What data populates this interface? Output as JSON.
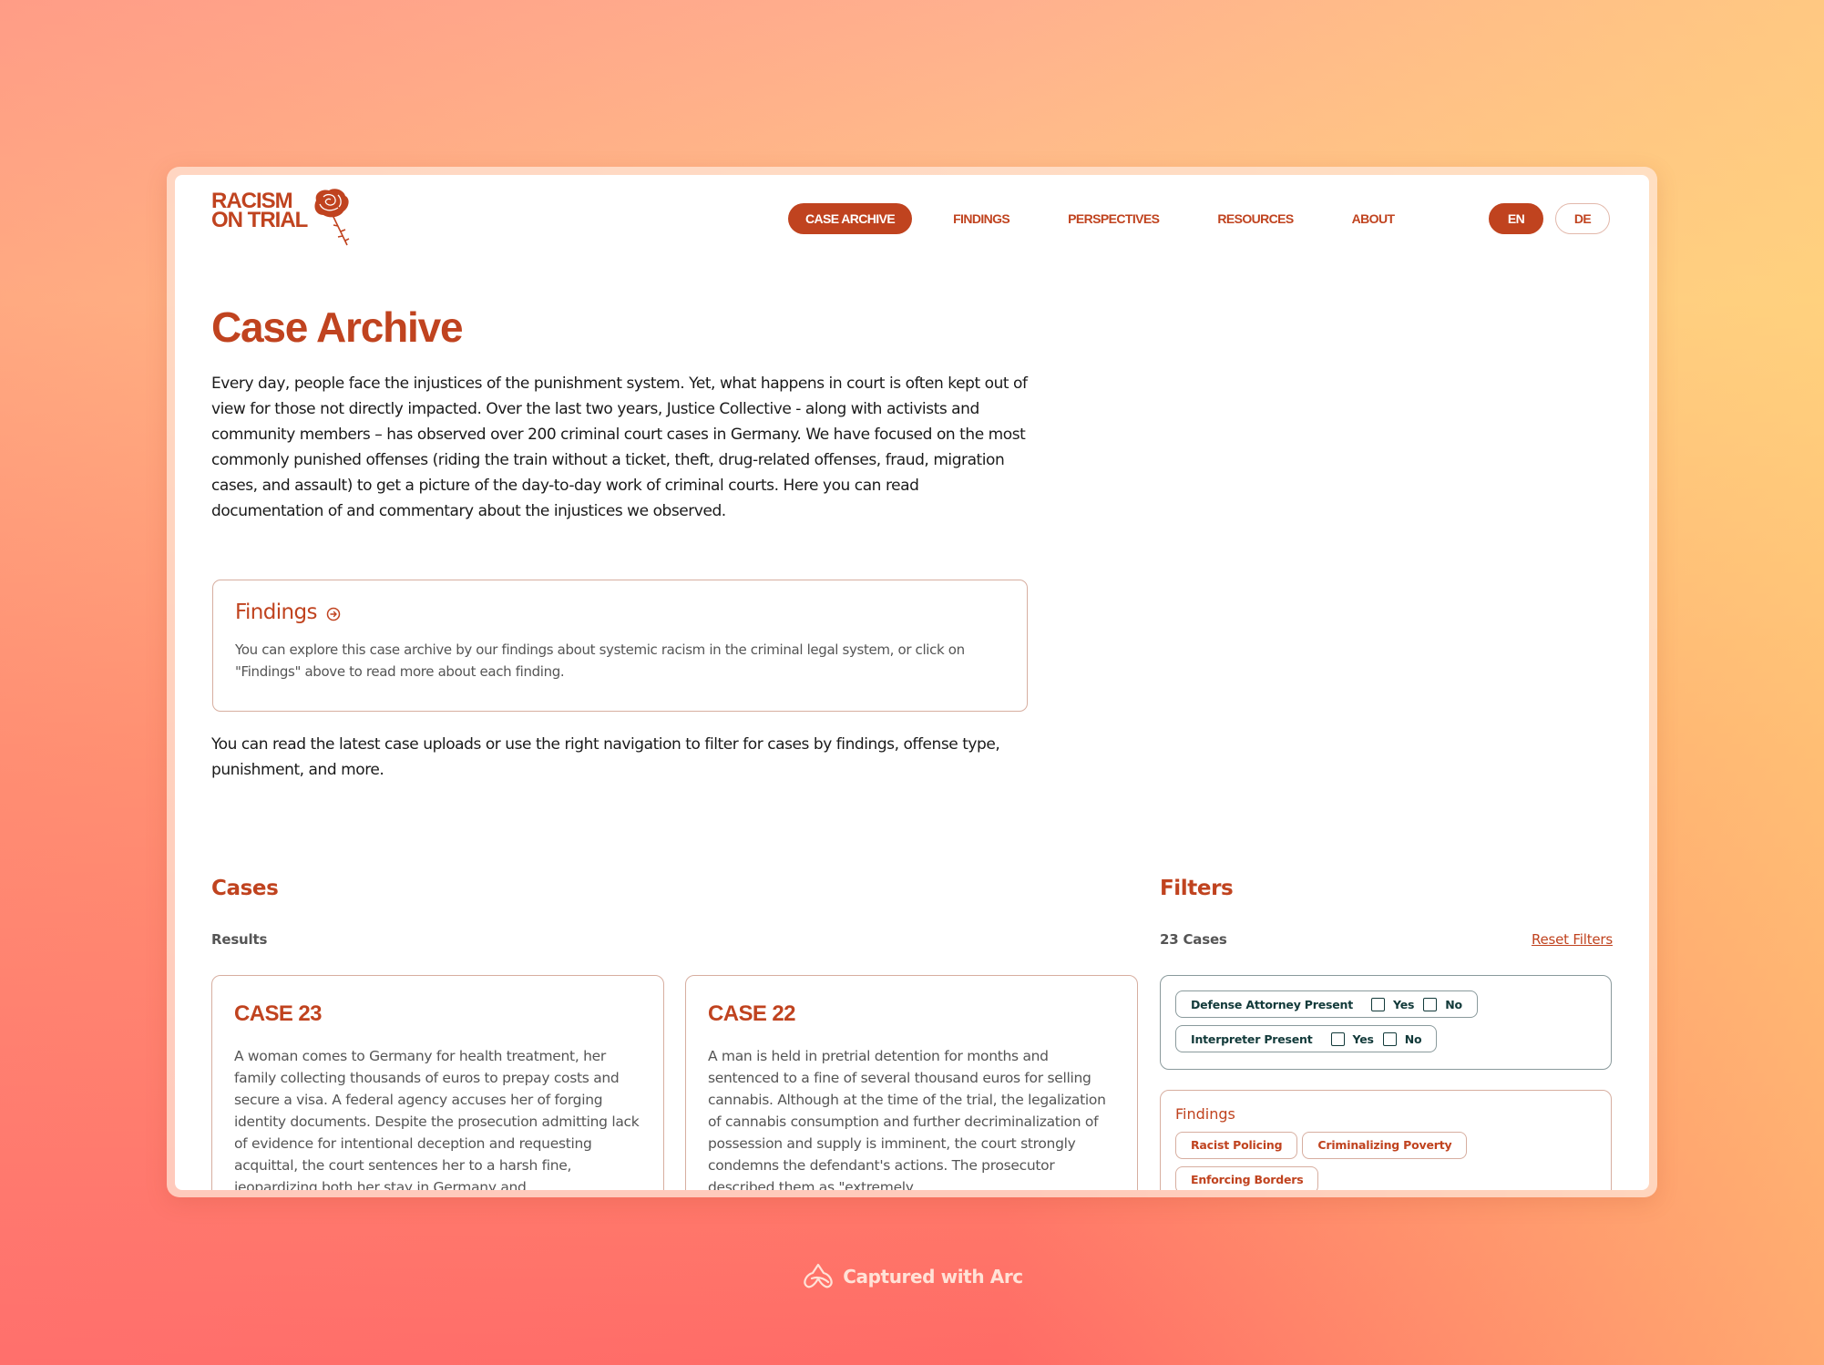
{
  "brand": {
    "line1": "RACISM",
    "line2": "ON TRIAL",
    "logo_icon": "rose-icon",
    "color": "#c0431f"
  },
  "nav": {
    "items": [
      {
        "label": "CASE ARCHIVE",
        "active": true
      },
      {
        "label": "FINDINGS",
        "active": false
      },
      {
        "label": "PERSPECTIVES",
        "active": false
      },
      {
        "label": "RESOURCES",
        "active": false
      },
      {
        "label": "ABOUT",
        "active": false
      }
    ],
    "languages": [
      {
        "label": "EN",
        "active": true
      },
      {
        "label": "DE",
        "active": false
      }
    ]
  },
  "page": {
    "title": "Case Archive",
    "intro": "Every day, people face the injustices of the punishment system. Yet, what happens in court is often kept out of view for those not directly impacted. Over the last two years, Justice Collective - along with activists and community members – has observed over 200 criminal court cases in Germany. We have focused on the most commonly punished offenses (riding the train without a ticket, theft, drug-related offenses, fraud, migration cases, and assault) to get a picture of the day-to-day work of criminal courts. Here you can read documentation of and commentary about the injustices we observed.",
    "findings_box": {
      "title": "Findings",
      "icon": "arrow-circle-right-icon",
      "description": "You can explore this case archive by our findings about systemic racism in the criminal legal system, or click on \"Findings\" above to read more about each finding."
    },
    "intro2": "You can read the latest case uploads or use the right navigation to filter for cases by findings, offense type, punishment, and more."
  },
  "cases": {
    "heading": "Cases",
    "results_label": "Results",
    "items": [
      {
        "title": "CASE 23",
        "summary": "A woman comes to Germany for health treatment, her family collecting thousands of euros to prepay costs and secure a visa. A federal agency accuses her of forging identity documents. Despite the prosecution admitting lack of evidence for intentional deception and requesting acquittal, the court sentences her to a harsh fine, jeopardizing both her stay in Germany and"
      },
      {
        "title": "CASE 22",
        "summary": "A man is held in pretrial detention for months and sentenced to a fine of several thousand euros for selling cannabis. Although at the time of the trial, the legalization of cannabis consumption and further decriminalization of possession and supply is imminent, the court strongly condemns the defendant's actions. The prosecutor described them as \"extremely"
      }
    ]
  },
  "filters": {
    "heading": "Filters",
    "count_label": "23 Cases",
    "reset_label": "Reset Filters",
    "toggles": [
      {
        "label": "Defense Attorney Present",
        "yes": "Yes",
        "no": "No",
        "yes_checked": false,
        "no_checked": false
      },
      {
        "label": "Interpreter Present",
        "yes": "Yes",
        "no": "No",
        "yes_checked": false,
        "no_checked": false
      }
    ],
    "findings": {
      "label": "Findings",
      "tags": [
        "Racist Policing",
        "Criminalizing Poverty",
        "Enforcing Borders"
      ]
    }
  },
  "footer": {
    "capture_label": "Captured with Arc",
    "icon": "arc-logo-icon"
  }
}
